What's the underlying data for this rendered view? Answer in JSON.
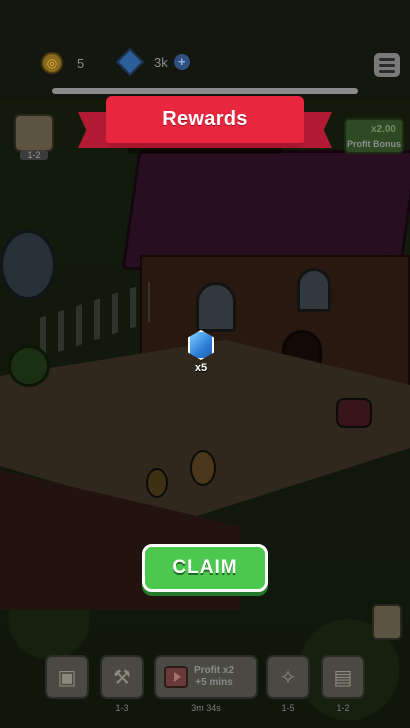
{
  "top_bar": {
    "coins": "5",
    "gems": "3k",
    "add_symbol": "+",
    "level_progress": 1.0
  },
  "left_widget": {
    "level_range": "1-2"
  },
  "profit_bonus": {
    "multiplier": "x2.00",
    "label": "Profit Bonus"
  },
  "reward_popup": {
    "title": "Rewards",
    "item_icon": "gem-icon",
    "item_quantity": "x5",
    "claim_label": "CLAIM"
  },
  "bottom_bar": {
    "items": [
      {
        "icon": "manager-icon",
        "caption": ""
      },
      {
        "icon": "hammer-icon",
        "caption": "1-3"
      },
      {
        "icon": "tv-ad-icon",
        "line1": "Profit x2",
        "line2": "+5 mins",
        "caption": "3m 34s"
      },
      {
        "icon": "guest-icon",
        "caption": "1-5"
      },
      {
        "icon": "furniture-icon",
        "caption": "1-2"
      }
    ]
  },
  "colors": {
    "ribbon": "#e8273f",
    "claim_button": "#4cc84f",
    "gem": "#2d7fd8"
  }
}
